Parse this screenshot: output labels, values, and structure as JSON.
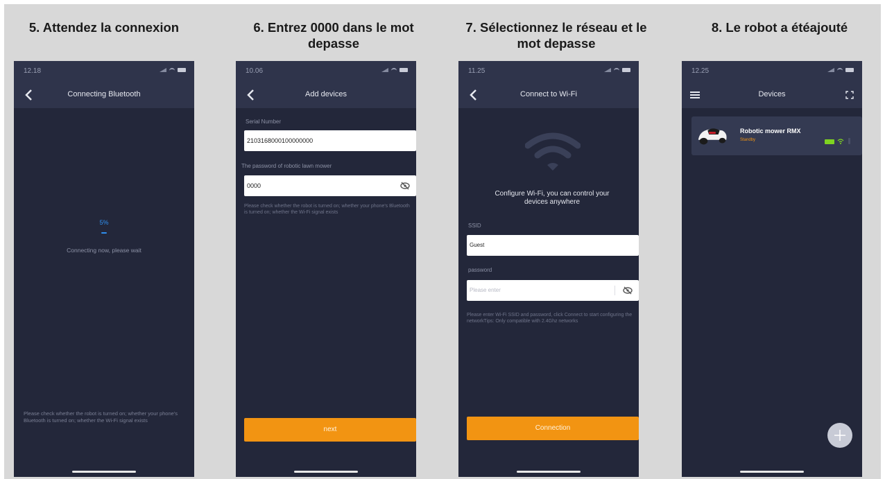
{
  "panels": [
    {
      "step_title": "5. Attendez la connexion",
      "time": "12.18",
      "nav_title": "Connecting Bluetooth",
      "progress_percent": "5%",
      "progress_value": 0.05,
      "status_text": "Connecting now, please wait",
      "bottom_hint": "Please check whether the robot is turned on; whether your phone's Bluetooth is turned on; whether the Wi-Fi signal exists"
    },
    {
      "step_title": "6. Entrez 0000 dans le mot depasse",
      "time": "10.06",
      "nav_title": "Add devices",
      "serial_label": "Serial Number",
      "serial_value": "2103168000100000000",
      "password_label": "The password of robotic lawn mower",
      "password_value": "0000",
      "hint": "Please check whether the robot is turned on; whether your phone's Bluetooth is turned on; whether the Wi-Fi signal exists",
      "next_label": "next"
    },
    {
      "step_title": "7. Sélectionnez le réseau et le mot depasse",
      "time": "11.25",
      "nav_title": "Connect to Wi-Fi",
      "configure_text": "Configure Wi-Fi, you can control your devices anywhere",
      "ssid_label": "SSID",
      "ssid_value": "Guest",
      "password_label": "password",
      "password_placeholder": "Please enter",
      "hint": "Please enter Wi-Fi SSID and password, click Connect to start configuring the networkTips: Only compatible with 2.4Ghz networks",
      "connect_label": "Connection"
    },
    {
      "step_title": "8. Le robot a étéajouté",
      "time": "12.25",
      "nav_title": "Devices",
      "device_name": "Robotic mower RMX",
      "device_status": "Standby"
    }
  ],
  "colors": {
    "background": "#d8d8d8",
    "phone_bg": "#23273a",
    "bar_bg": "#2f344b",
    "accent_orange": "#f29412",
    "progress_blue": "#2f8ff0",
    "battery_green": "#7ed321"
  },
  "icons": [
    "back-chevron-icon",
    "hamburger-menu-icon",
    "scan-icon",
    "eye-hidden-icon",
    "wifi-icon",
    "battery-icon",
    "bluetooth-icon",
    "plus-icon"
  ]
}
